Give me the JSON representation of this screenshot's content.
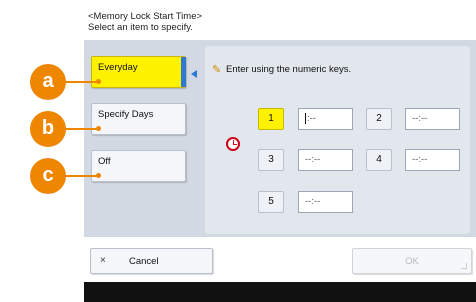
{
  "header": {
    "title": "<Memory Lock Start Time>",
    "subtitle": "Select an item to specify."
  },
  "options": [
    {
      "label": "Everyday",
      "selected": true
    },
    {
      "label": "Specify Days",
      "selected": false
    },
    {
      "label": "Off",
      "selected": false
    }
  ],
  "instruction": "Enter using the numeric keys.",
  "times": [
    {
      "key": "1",
      "value": ":--",
      "active": true
    },
    {
      "key": "2",
      "value": "--:--",
      "active": false
    },
    {
      "key": "3",
      "value": "--:--",
      "active": false
    },
    {
      "key": "4",
      "value": "--:--",
      "active": false
    },
    {
      "key": "5",
      "value": "--:--",
      "active": false
    }
  ],
  "buttons": {
    "cancel_icon": "×",
    "cancel_label": "Cancel",
    "ok_label": "OK"
  },
  "callouts": [
    "a",
    "b",
    "c"
  ],
  "icons": {
    "instruction_icon": "pen-icon",
    "clock_icon": "clock-icon"
  },
  "colors": {
    "selected": "#fff200",
    "accent": "#2e7ad1",
    "callout": "#ee8600",
    "clock": "#d0001a"
  }
}
